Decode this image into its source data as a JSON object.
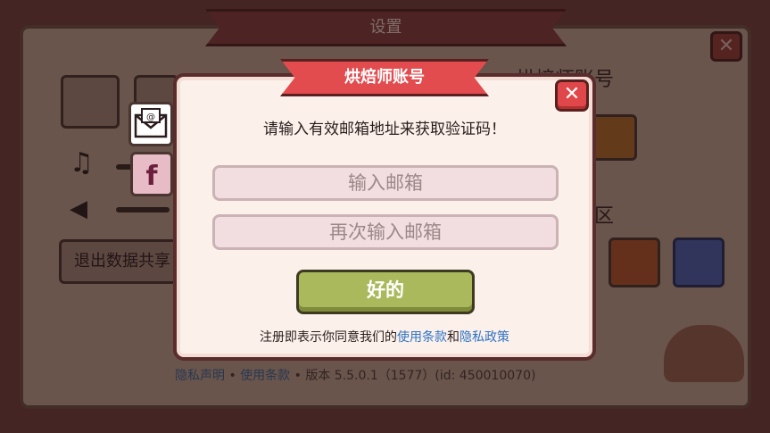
{
  "background": {
    "settings_title": "设置",
    "settings_close": "✕",
    "exit_data_sharing_label": "退出数据共享",
    "account_title": "烘焙师账号",
    "community_label": "区",
    "footer": {
      "privacy": "隐私声明",
      "separator": "•",
      "terms": "使用条款",
      "version": "版本 5.5.0.1（1577）(id: 450010070)"
    },
    "icons": [
      "globe-icon",
      "support-icon",
      "mail-icon",
      "facebook-icon",
      "music-icon",
      "volume-icon",
      "reddit-icon",
      "discord-icon"
    ]
  },
  "modal": {
    "title": "烘焙师账号",
    "close_glyph": "✕",
    "instruction": "请输入有效邮箱地址来获取验证码！",
    "email_placeholder": "输入邮箱",
    "confirm_placeholder": "再次输入邮箱",
    "ok_label": "好的",
    "terms": {
      "prefix": "注册即表示你同意我们的",
      "terms_link": "使用条款",
      "and": "和",
      "privacy_link": "隐私政策"
    }
  },
  "colors": {
    "banner_red": "#e24c4f",
    "ok_green": "#a9b95b",
    "link_blue": "#2f73c8"
  }
}
